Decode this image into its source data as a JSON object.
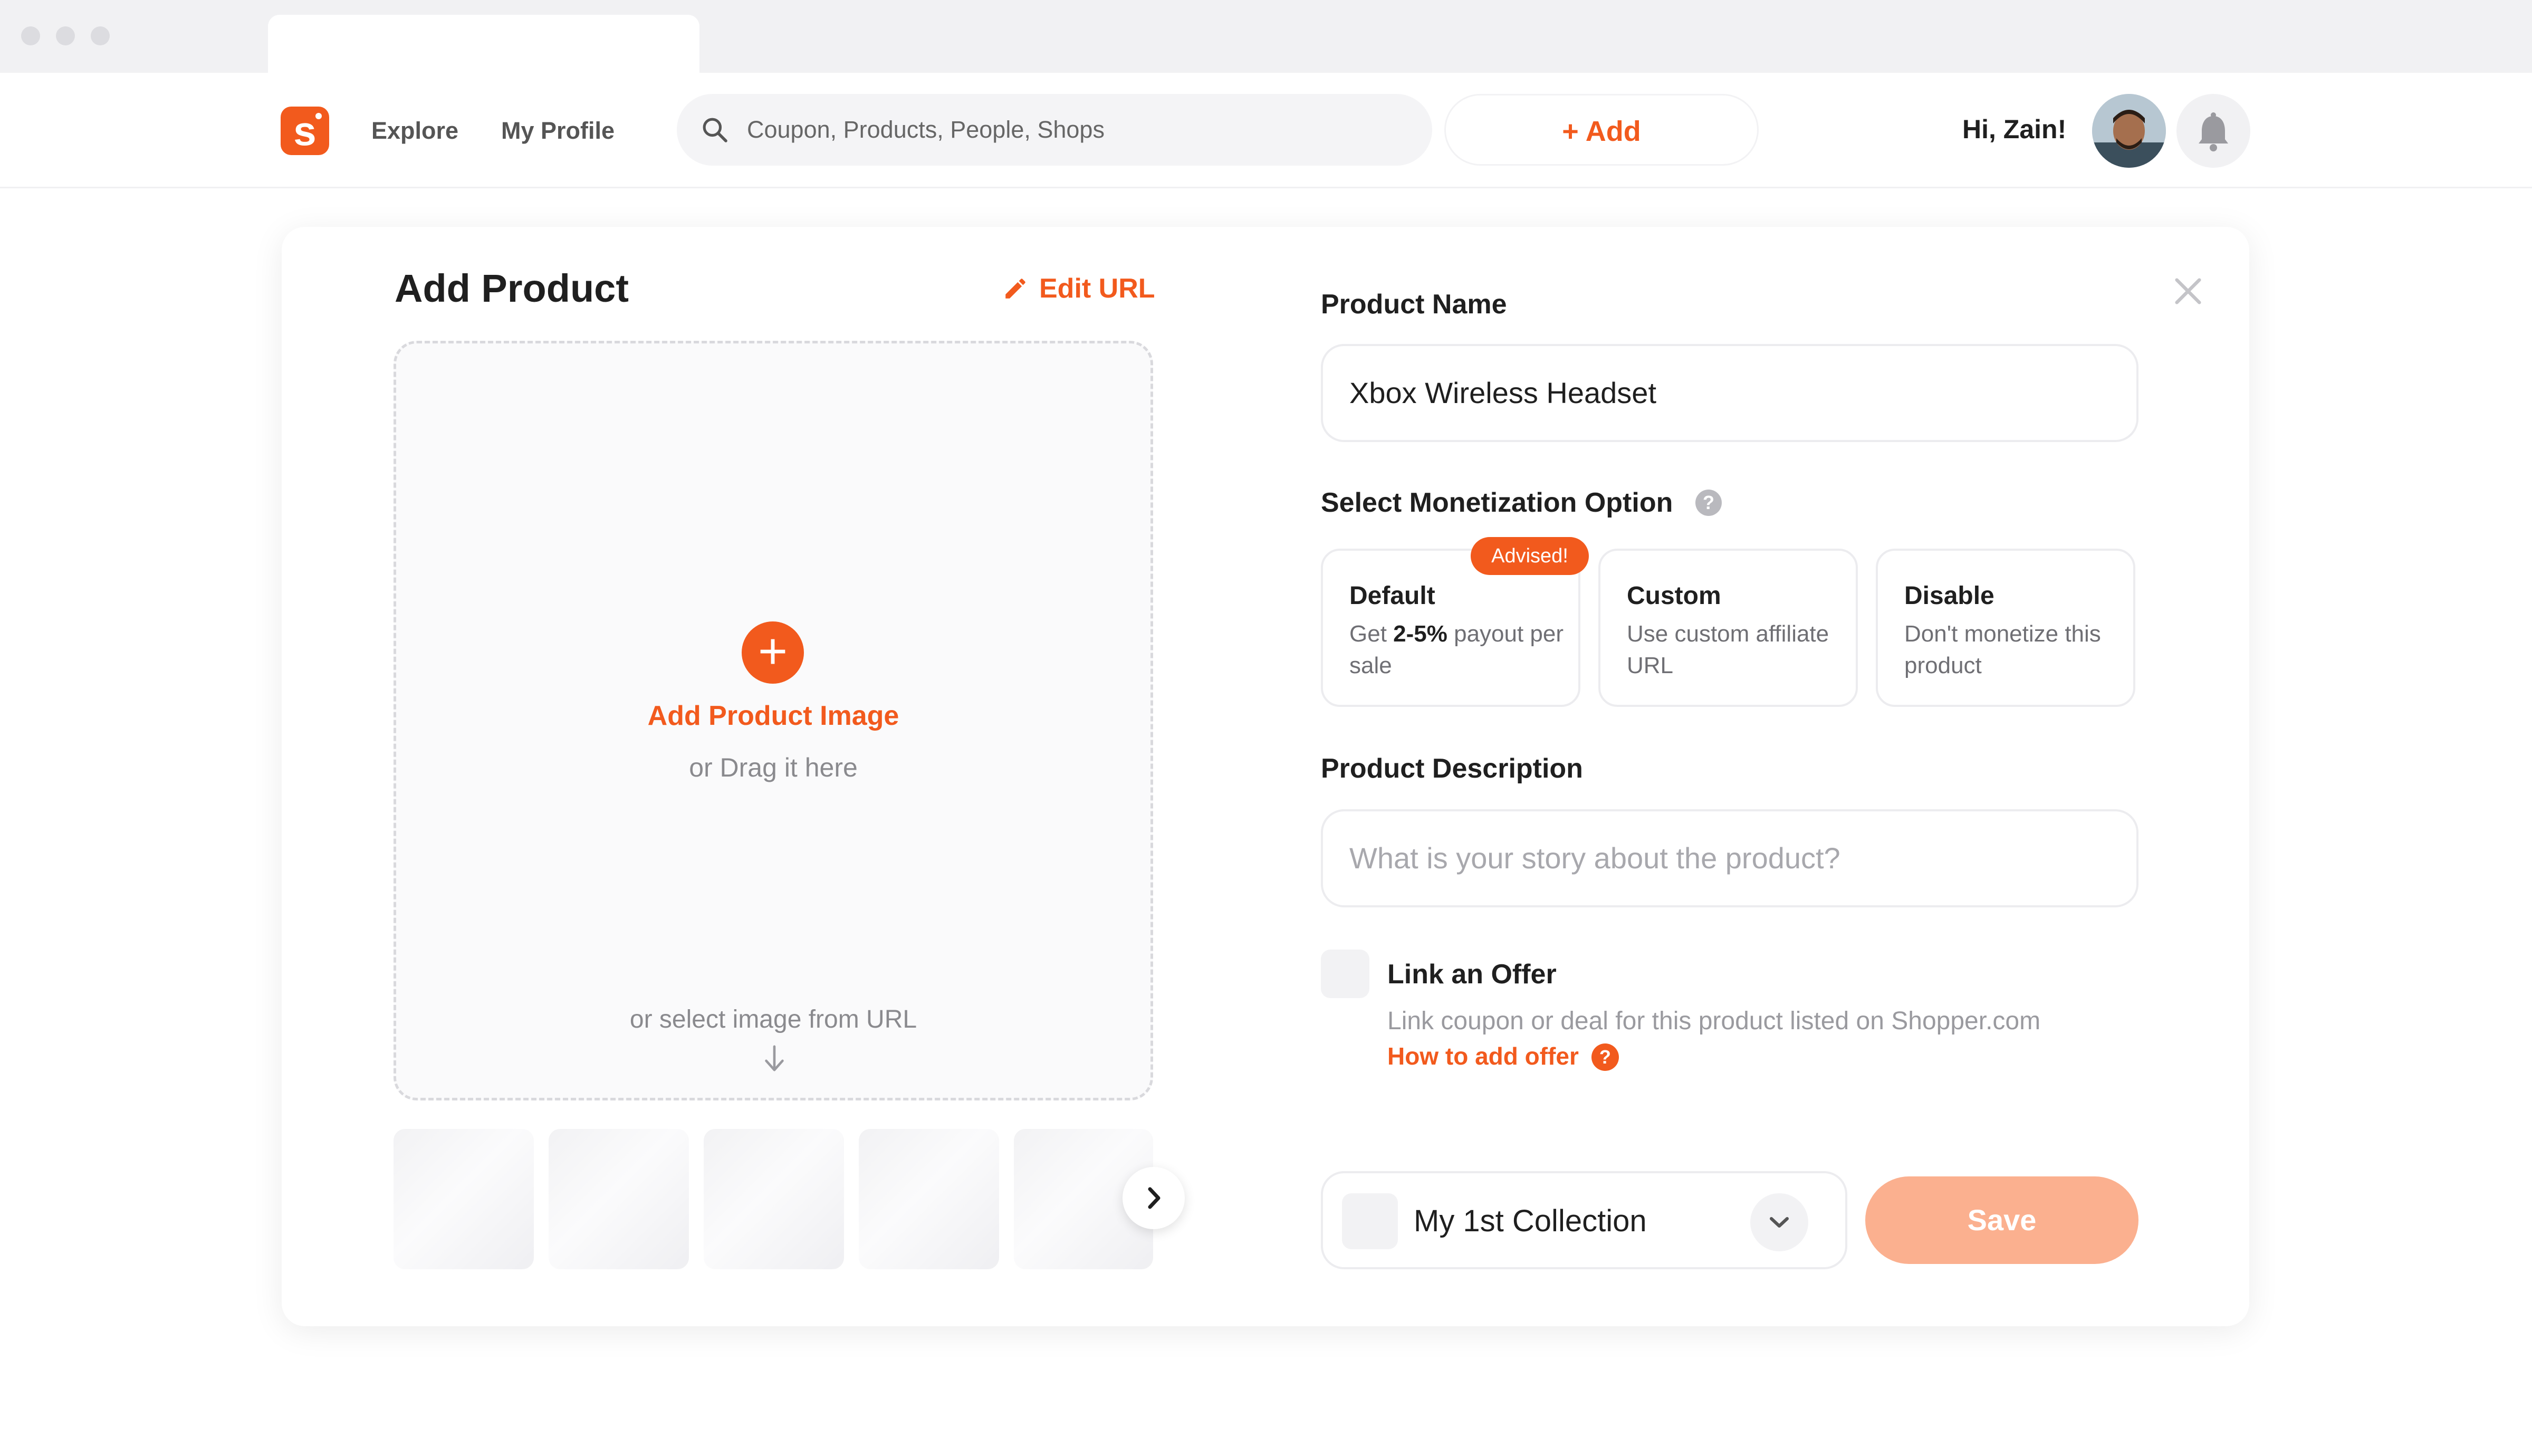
{
  "nav": {
    "links": [
      "Explore",
      "My Profile"
    ],
    "search_placeholder": "Coupon, Products, People, Shops",
    "add_label": "+ Add",
    "greeting": "Hi, Zain!"
  },
  "colors": {
    "accent": "#f25a1d",
    "save_disabled": "#fbb08f"
  },
  "icons": [
    "logo-s-icon",
    "search-icon",
    "avatar",
    "bell-icon",
    "pencil-icon",
    "plus-icon",
    "arrow-down-icon",
    "chevron-right-icon",
    "close-icon",
    "help-icon",
    "chevron-down-icon"
  ],
  "panel": {
    "title": "Add Product",
    "edit_url": "Edit URL",
    "add_image": "Add Product Image",
    "drag": "or Drag it here",
    "select_url": "or select image from URL"
  },
  "form": {
    "product_name_label": "Product Name",
    "product_name_value": "Xbox Wireless Headset",
    "monetization_label": "Select Monetization Option",
    "advised_badge": "Advised!",
    "options": [
      {
        "title": "Default",
        "desc_prefix": "Get ",
        "desc_bold": "2-5%",
        "desc_suffix": " payout per sale"
      },
      {
        "title": "Custom",
        "desc": "Use custom affiliate URL"
      },
      {
        "title": "Disable",
        "desc": "Don't monetize this product"
      }
    ],
    "description_label": "Product Description",
    "description_placeholder": "What is your story about the product?",
    "offer_label": "Link an Offer",
    "offer_desc": "Link coupon or deal for this product listed on Shopper.com",
    "offer_link": "How to add offer",
    "collection": "My 1st Collection",
    "save": "Save"
  }
}
